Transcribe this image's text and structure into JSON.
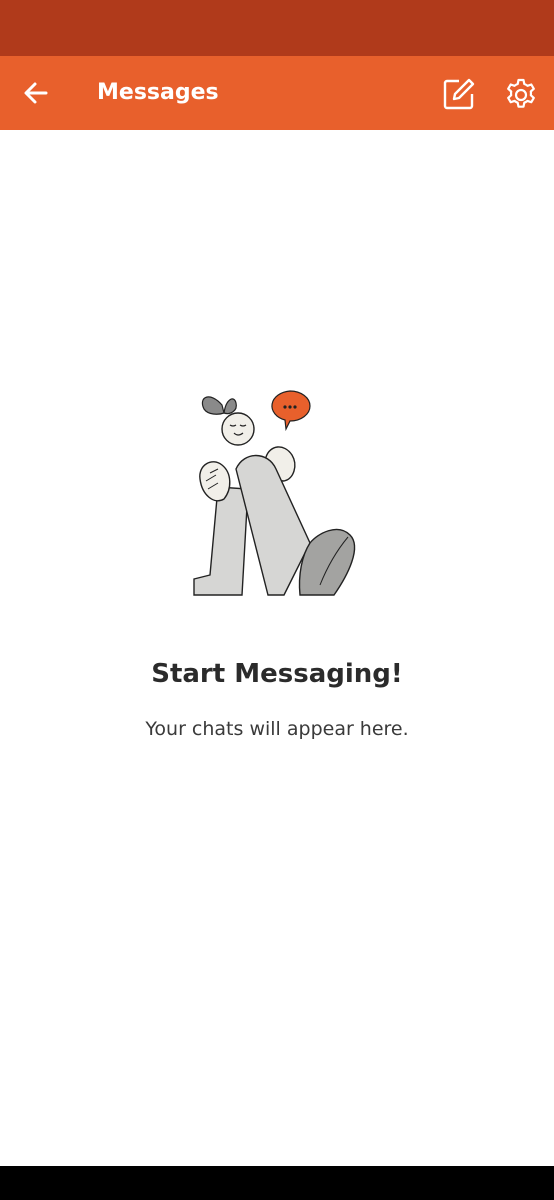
{
  "colors": {
    "status_bar": "#b03a1b",
    "app_bar": "#e8602c",
    "background": "#ffffff",
    "title_text": "#2b2b2b",
    "accent_bubble": "#e8602c"
  },
  "app_bar": {
    "title": "Messages",
    "back_icon": "arrow-left-icon",
    "compose_icon": "compose-icon",
    "settings_icon": "gear-icon"
  },
  "empty_state": {
    "title": "Start Messaging!",
    "subtitle": "Your chats will appear here."
  }
}
